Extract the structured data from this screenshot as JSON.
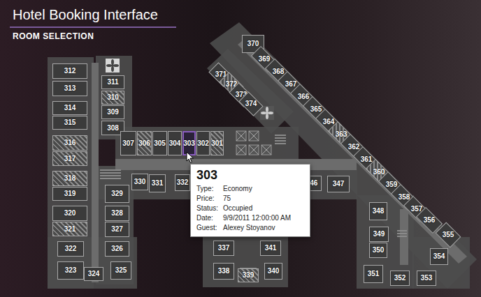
{
  "header": {
    "title": "Hotel Booking Interface",
    "subtitle": "ROOM SELECTION"
  },
  "rooms": [
    {
      "number": "312",
      "booked": false,
      "selected": false
    },
    {
      "number": "313",
      "booked": false,
      "selected": false
    },
    {
      "number": "314",
      "booked": false,
      "selected": false
    },
    {
      "number": "315",
      "booked": false,
      "selected": false
    },
    {
      "number": "316",
      "booked": true,
      "selected": false
    },
    {
      "number": "317",
      "booked": true,
      "selected": false
    },
    {
      "number": "318",
      "booked": true,
      "selected": false
    },
    {
      "number": "319",
      "booked": false,
      "selected": false
    },
    {
      "number": "320",
      "booked": false,
      "selected": false
    },
    {
      "number": "321",
      "booked": true,
      "selected": false
    },
    {
      "number": "322",
      "booked": false,
      "selected": false
    },
    {
      "number": "323",
      "booked": false,
      "selected": false
    },
    {
      "number": "324",
      "booked": false,
      "selected": false
    },
    {
      "number": "325",
      "booked": false,
      "selected": false
    },
    {
      "number": "326",
      "booked": false,
      "selected": false
    },
    {
      "number": "327",
      "booked": false,
      "selected": false
    },
    {
      "number": "328",
      "booked": false,
      "selected": false
    },
    {
      "number": "329",
      "booked": false,
      "selected": false
    },
    {
      "number": "311",
      "booked": false,
      "selected": false
    },
    {
      "number": "310",
      "booked": true,
      "selected": false
    },
    {
      "number": "309",
      "booked": false,
      "selected": false
    },
    {
      "number": "308",
      "booked": false,
      "selected": false
    },
    {
      "number": "307",
      "booked": false,
      "selected": false
    },
    {
      "number": "306",
      "booked": true,
      "selected": false
    },
    {
      "number": "305",
      "booked": false,
      "selected": false
    },
    {
      "number": "304",
      "booked": false,
      "selected": false
    },
    {
      "number": "303",
      "booked": false,
      "selected": true
    },
    {
      "number": "302",
      "booked": false,
      "selected": false
    },
    {
      "number": "301",
      "booked": true,
      "selected": false
    },
    {
      "number": "330",
      "booked": false,
      "selected": false
    },
    {
      "number": "331",
      "booked": false,
      "selected": false
    },
    {
      "number": "332",
      "booked": false,
      "selected": false
    },
    {
      "number": "346",
      "booked": false,
      "selected": false
    },
    {
      "number": "347",
      "booked": false,
      "selected": false
    },
    {
      "number": "337",
      "booked": false,
      "selected": false
    },
    {
      "number": "341",
      "booked": false,
      "selected": false
    },
    {
      "number": "338",
      "booked": false,
      "selected": false
    },
    {
      "number": "339",
      "booked": true,
      "selected": false
    },
    {
      "number": "340",
      "booked": false,
      "selected": false
    },
    {
      "number": "370",
      "booked": false,
      "selected": false
    },
    {
      "number": "348",
      "booked": false,
      "selected": false
    },
    {
      "number": "349",
      "booked": false,
      "selected": false
    },
    {
      "number": "350",
      "booked": false,
      "selected": false
    },
    {
      "number": "351",
      "booked": false,
      "selected": false
    },
    {
      "number": "352",
      "booked": false,
      "selected": false
    },
    {
      "number": "353",
      "booked": false,
      "selected": false
    },
    {
      "number": "354",
      "booked": false,
      "selected": false
    },
    {
      "number": "369",
      "booked": false,
      "selected": false
    },
    {
      "number": "368",
      "booked": false,
      "selected": false
    },
    {
      "number": "367",
      "booked": false,
      "selected": false
    },
    {
      "number": "366",
      "booked": false,
      "selected": false
    },
    {
      "number": "365",
      "booked": false,
      "selected": false
    },
    {
      "number": "364",
      "booked": false,
      "selected": false
    },
    {
      "number": "363",
      "booked": true,
      "selected": false
    },
    {
      "number": "362",
      "booked": false,
      "selected": false
    },
    {
      "number": "361",
      "booked": false,
      "selected": false
    },
    {
      "number": "360",
      "booked": true,
      "selected": false
    },
    {
      "number": "359",
      "booked": false,
      "selected": false
    },
    {
      "number": "358",
      "booked": false,
      "selected": false
    },
    {
      "number": "357",
      "booked": false,
      "selected": false
    },
    {
      "number": "356",
      "booked": false,
      "selected": false
    },
    {
      "number": "355",
      "booked": false,
      "selected": false
    },
    {
      "number": "371",
      "booked": false,
      "selected": false
    },
    {
      "number": "372",
      "booked": true,
      "selected": false
    },
    {
      "number": "373",
      "booked": false,
      "selected": false
    },
    {
      "number": "374",
      "booked": false,
      "selected": false
    }
  ],
  "tooltip": {
    "title": "303",
    "fields": [
      {
        "label": "Type:",
        "value": "Economy"
      },
      {
        "label": "Price:",
        "value": "75"
      },
      {
        "label": "Status:",
        "value": "Occupied"
      },
      {
        "label": "Date:",
        "value": "9/9/2011 12:00:00 AM"
      },
      {
        "label": "Guest:",
        "value": "Alexey Stoyanov"
      }
    ]
  }
}
